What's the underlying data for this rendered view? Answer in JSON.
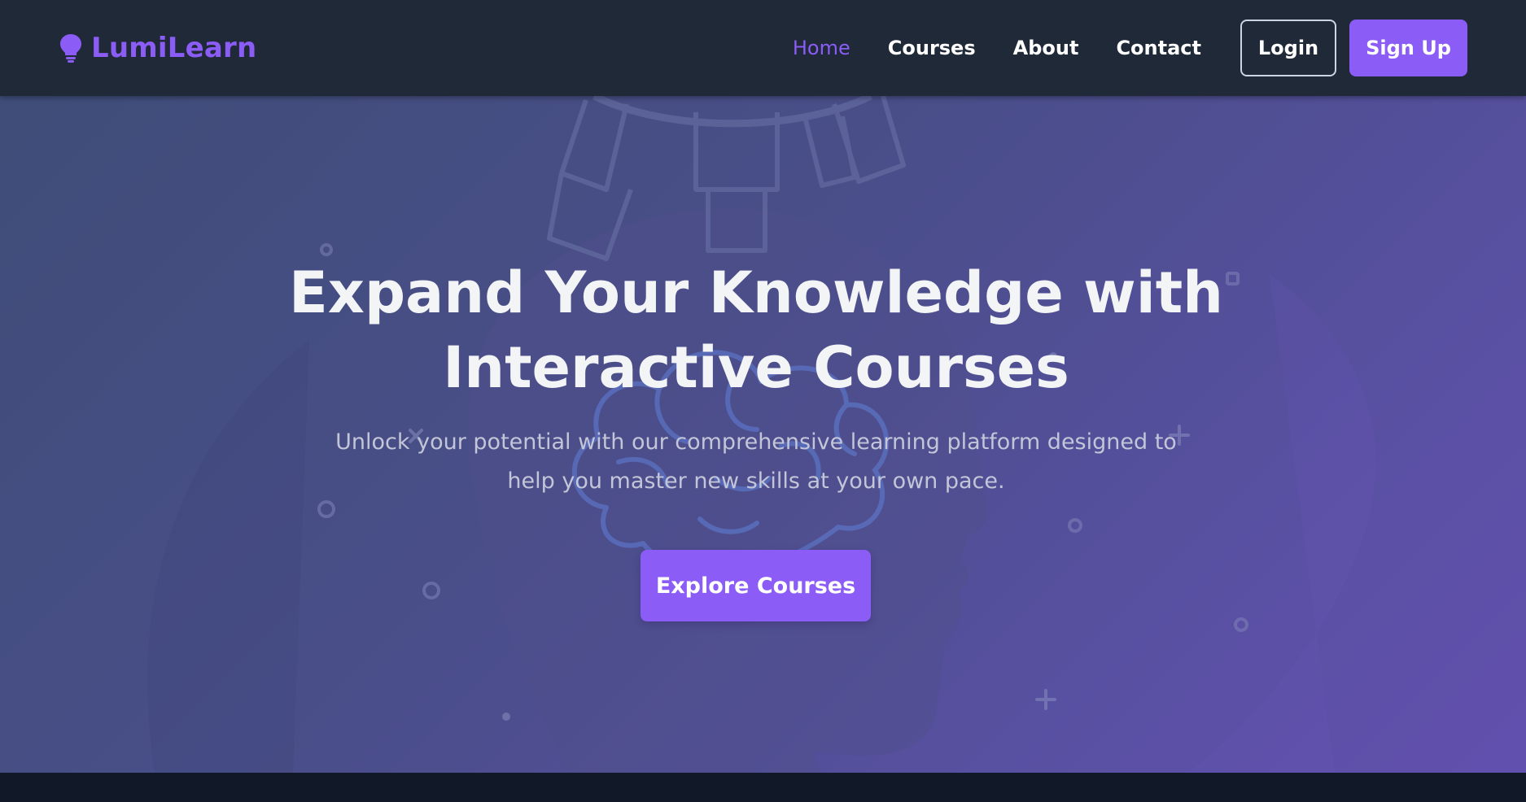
{
  "brand": {
    "name": "LumiLearn",
    "icon": "lightbulb-icon",
    "color": "#8b5cf6"
  },
  "nav": {
    "links": [
      {
        "label": "Home",
        "active": true
      },
      {
        "label": "Courses",
        "active": false
      },
      {
        "label": "About",
        "active": false
      },
      {
        "label": "Contact",
        "active": false
      }
    ],
    "login_label": "Login",
    "signup_label": "Sign Up"
  },
  "hero": {
    "title_line1": "Expand Your Knowledge with",
    "title_line2": "Interactive Courses",
    "subtitle": "Unlock your potential with our comprehensive learning platform designed to help you master new skills at your own pace.",
    "cta_label": "Explore Courses"
  },
  "colors": {
    "accent": "#8b5cf6",
    "navbar": "#1f2937",
    "page_bg": "#111827",
    "hero_gradient_start": "#3f4d78",
    "hero_gradient_end": "#6250ae"
  }
}
